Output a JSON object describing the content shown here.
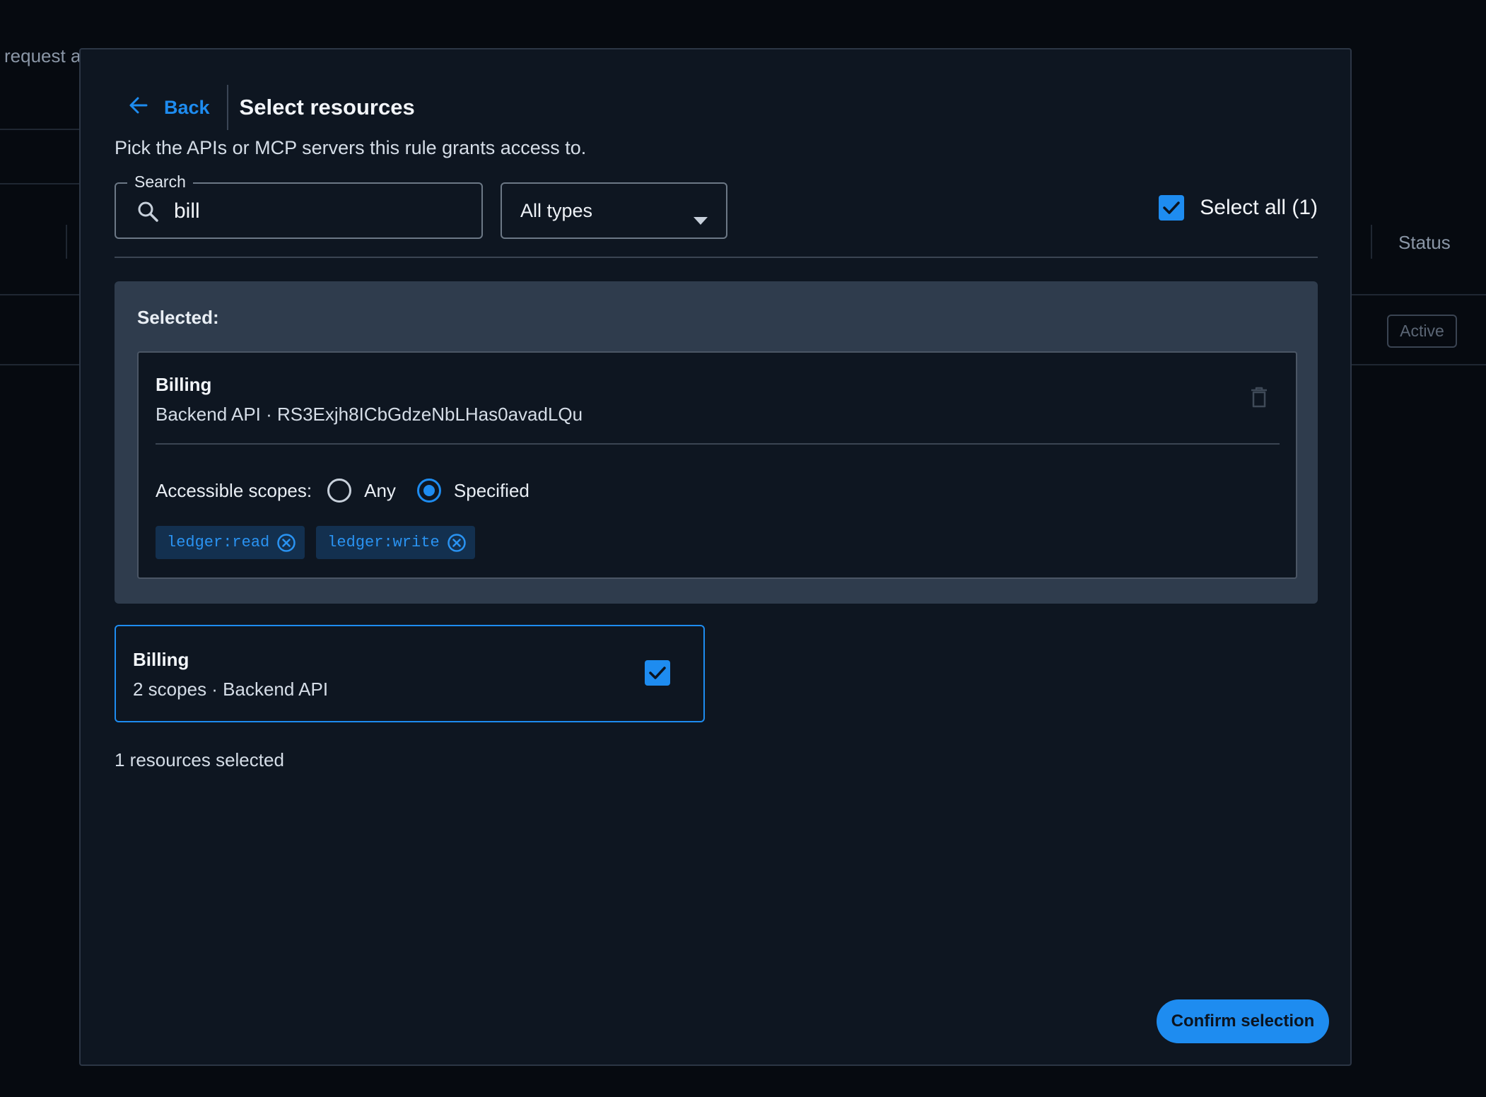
{
  "background": {
    "fragment_text": "request a",
    "status_header": "Status",
    "status_badge": "Active"
  },
  "modal": {
    "back_label": "Back",
    "title": "Select resources",
    "subtitle": "Pick the APIs or MCP servers this rule grants access to.",
    "search": {
      "legend": "Search",
      "value": "bill",
      "icon": "search-icon"
    },
    "type_filter": {
      "selected": "All types"
    },
    "select_all": {
      "label": "Select all (1)",
      "checked": true
    },
    "selected_section": {
      "label": "Selected:",
      "items": [
        {
          "name": "Billing",
          "meta": "Backend API · RS3Exjh8ICbGdzeNbLHas0avadLQu",
          "scopes_label": "Accessible scopes:",
          "scope_options": [
            "Any",
            "Specified"
          ],
          "scope_mode": "Specified",
          "scopes": [
            "ledger:read",
            "ledger:write"
          ]
        }
      ]
    },
    "results": [
      {
        "name": "Billing",
        "meta": "2 scopes · Backend API",
        "checked": true
      }
    ],
    "count_text": "1 resources selected",
    "confirm_label": "Confirm selection"
  },
  "colors": {
    "accent": "#1e8cf0",
    "modal_bg": "#0e1621",
    "panel_bg": "#2f3c4d",
    "page_bg": "#060a10"
  }
}
